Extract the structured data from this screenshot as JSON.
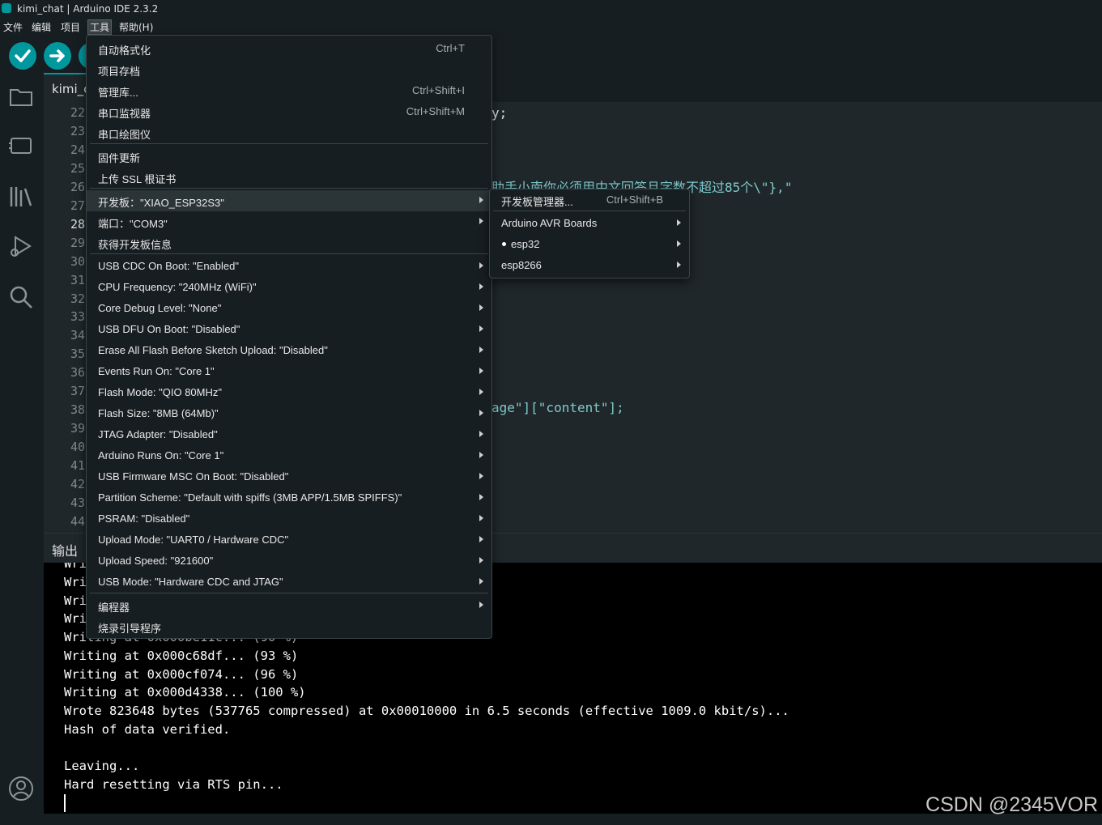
{
  "window": {
    "title": "kimi_chat | Arduino IDE 2.3.2"
  },
  "menubar": {
    "items": [
      "文件",
      "编辑",
      "项目",
      "工具",
      "帮助(H)"
    ]
  },
  "toolbar": {
    "verify_icon": "check-icon",
    "upload_icon": "arrow-right-icon"
  },
  "editor": {
    "tab_label": "kimi_c",
    "line_numbers": [
      "22",
      "23",
      "24",
      "25",
      "26",
      "27",
      "28",
      "29",
      "30",
      "31",
      "32",
      "33",
      "34",
      "35",
      "36",
      "37",
      "38",
      "39",
      "40",
      "41",
      "42",
      "43",
      "44"
    ],
    "current_line": "28",
    "visible_code": {
      "line22": "y;",
      "line26_prefix": "助手小南",
      "line26_rest": "你必须用中文回答且字数不超过85个\\\"},\"",
      "line38": "age\"][\"content\"];"
    }
  },
  "output": {
    "label": "输出",
    "lines": [
      "Wri",
      "Wri",
      "Wri",
      "Wri",
      "Writing at 0x000be11c... (90 %)",
      "Writing at 0x000c68df... (93 %)",
      "Writing at 0x000cf074... (96 %)",
      "Writing at 0x000d4338... (100 %)",
      "Wrote 823648 bytes (537765 compressed) at 0x00010000 in 6.5 seconds (effective 1009.0 kbit/s)...",
      "Hash of data verified.",
      "",
      "Leaving...",
      "Hard resetting via RTS pin..."
    ]
  },
  "tools_menu": {
    "items": [
      {
        "label": "自动格式化",
        "shortcut": "Ctrl+T"
      },
      {
        "label": "项目存档",
        "shortcut": ""
      },
      {
        "label": "管理库...",
        "shortcut": "Ctrl+Shift+I"
      },
      {
        "label": "串口监视器",
        "shortcut": "Ctrl+Shift+M"
      },
      {
        "label": "串口绘图仪",
        "shortcut": ""
      },
      {
        "label": "固件更新",
        "shortcut": ""
      },
      {
        "label": "上传 SSL 根证书",
        "shortcut": ""
      },
      {
        "label": "开发板：\"XIAO_ESP32S3\"",
        "shortcut": ""
      },
      {
        "label": "端口：\"COM3\"",
        "shortcut": ""
      },
      {
        "label": "获得开发板信息",
        "shortcut": ""
      },
      {
        "label": "USB CDC On Boot: \"Enabled\"",
        "shortcut": ""
      },
      {
        "label": "CPU Frequency: \"240MHz (WiFi)\"",
        "shortcut": ""
      },
      {
        "label": "Core Debug Level: \"None\"",
        "shortcut": ""
      },
      {
        "label": "USB DFU On Boot: \"Disabled\"",
        "shortcut": ""
      },
      {
        "label": "Erase All Flash Before Sketch Upload: \"Disabled\"",
        "shortcut": ""
      },
      {
        "label": "Events Run On: \"Core 1\"",
        "shortcut": ""
      },
      {
        "label": "Flash Mode: \"QIO 80MHz\"",
        "shortcut": ""
      },
      {
        "label": "Flash Size: \"8MB (64Mb)\"",
        "shortcut": ""
      },
      {
        "label": "JTAG Adapter: \"Disabled\"",
        "shortcut": ""
      },
      {
        "label": "Arduino Runs On: \"Core 1\"",
        "shortcut": ""
      },
      {
        "label": "USB Firmware MSC On Boot: \"Disabled\"",
        "shortcut": ""
      },
      {
        "label": "Partition Scheme: \"Default with spiffs (3MB APP/1.5MB SPIFFS)\"",
        "shortcut": ""
      },
      {
        "label": "PSRAM: \"Disabled\"",
        "shortcut": ""
      },
      {
        "label": "Upload Mode: \"UART0 / Hardware CDC\"",
        "shortcut": ""
      },
      {
        "label": "Upload Speed: \"921600\"",
        "shortcut": ""
      },
      {
        "label": "USB Mode: \"Hardware CDC and JTAG\"",
        "shortcut": ""
      },
      {
        "label": "编程器",
        "shortcut": ""
      },
      {
        "label": "烧录引导程序",
        "shortcut": ""
      }
    ]
  },
  "board_submenu": {
    "items": [
      {
        "label": "开发板管理器...",
        "shortcut": "Ctrl+Shift+B"
      },
      {
        "label": "Arduino AVR Boards",
        "shortcut": ""
      },
      {
        "label": "esp32",
        "shortcut": ""
      },
      {
        "label": "esp8266",
        "shortcut": ""
      }
    ]
  },
  "watermark": "CSDN @2345VOR"
}
